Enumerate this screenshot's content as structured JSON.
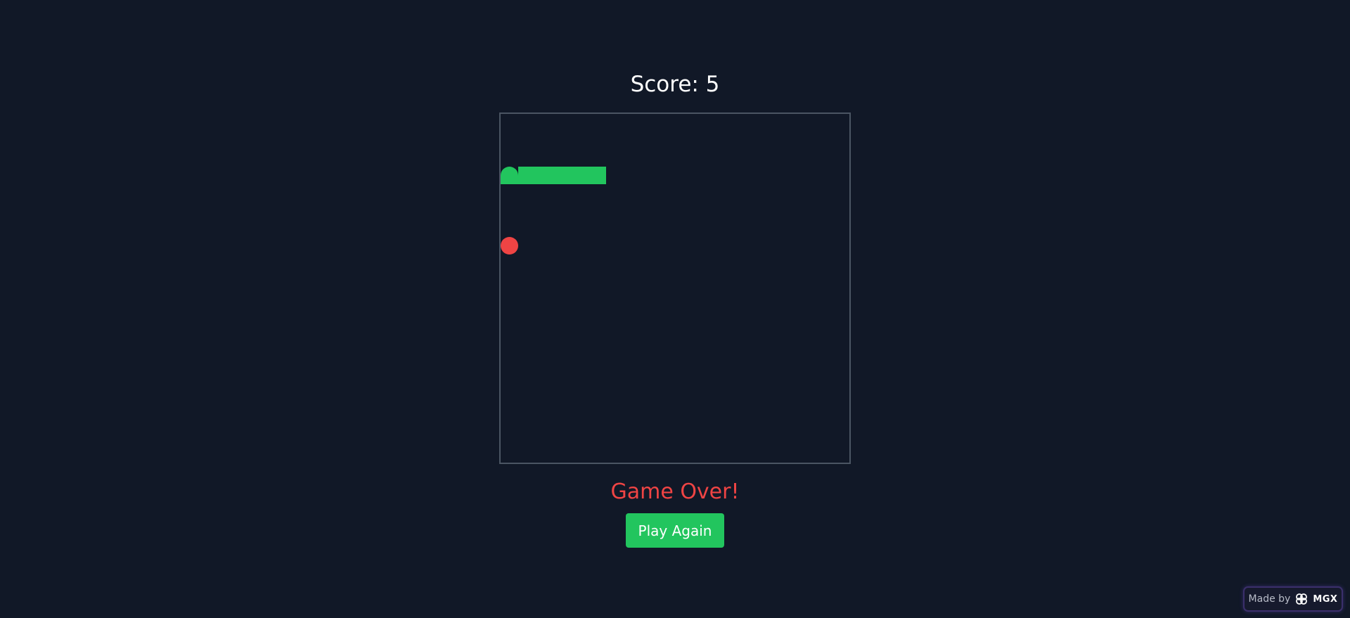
{
  "game": {
    "score_label": "Score: 5",
    "status": "Game Over!",
    "play_again_label": "Play Again"
  },
  "board": {
    "grid": 20,
    "snake": [
      [
        0,
        3
      ],
      [
        1,
        3
      ],
      [
        2,
        3
      ],
      [
        3,
        3
      ],
      [
        4,
        3
      ],
      [
        5,
        3
      ]
    ],
    "food": [
      0,
      7
    ],
    "colors": {
      "snake": "#22c55e",
      "food": "#ef4444",
      "border": "#4b5563",
      "background": "#111827"
    }
  },
  "badge": {
    "prefix": "Made by",
    "brand": "MGX"
  }
}
